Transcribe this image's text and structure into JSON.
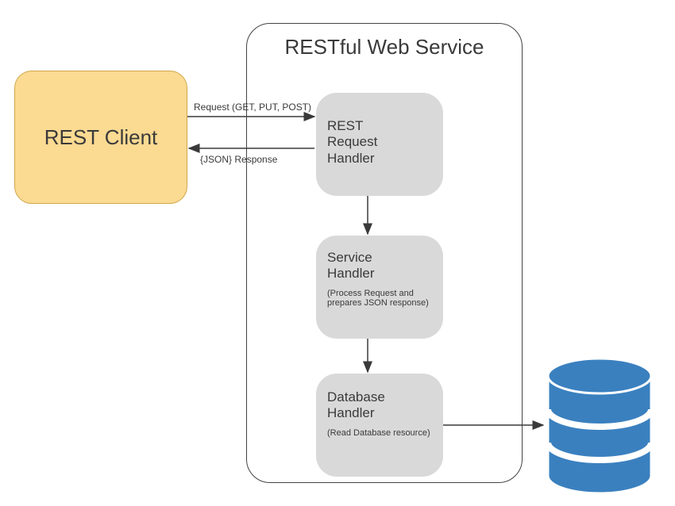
{
  "client": {
    "label": "REST Client"
  },
  "service": {
    "title": "RESTful Web Service"
  },
  "arrows": {
    "request": "Request (GET, PUT, POST)",
    "response": "{JSON} Response"
  },
  "handlers": {
    "request": {
      "title1": "REST",
      "title2": "Request",
      "title3": "Handler"
    },
    "service": {
      "title1": "Service",
      "title2": "Handler",
      "sub": "(Process Request and prepares JSON response)"
    },
    "database": {
      "title1": "Database",
      "title2": "Handler",
      "sub": "(Read Database resource)"
    }
  }
}
